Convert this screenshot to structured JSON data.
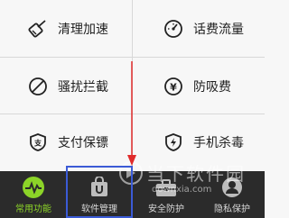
{
  "grid": {
    "items": [
      {
        "label": "清理加速",
        "icon": "broom-icon"
      },
      {
        "label": "话费流量",
        "icon": "speedometer-icon"
      },
      {
        "label": "骚扰拦截",
        "icon": "block-icon"
      },
      {
        "label": "防吸费",
        "icon": "yen-icon"
      },
      {
        "label": "支付保镖",
        "icon": "pay-shield-icon"
      },
      {
        "label": "手机杀毒",
        "icon": "lightning-shield-icon"
      }
    ]
  },
  "tabbar": {
    "tabs": [
      {
        "label": "常用功能",
        "icon": "pulse-icon",
        "active": true
      },
      {
        "label": "软件管理",
        "icon": "bag-icon",
        "active": false
      },
      {
        "label": "安全防护",
        "icon": "toolbox-icon",
        "active": false
      },
      {
        "label": "隐私保护",
        "icon": "user-lock-icon",
        "active": false
      }
    ]
  },
  "watermark": {
    "text": "当下软件园",
    "url": "downxia.com"
  },
  "colors": {
    "accent": "#8cd428",
    "tabbar_bg": "#2b2b2b",
    "highlight": "#3b5bd6",
    "arrow": "#e02b2b"
  }
}
